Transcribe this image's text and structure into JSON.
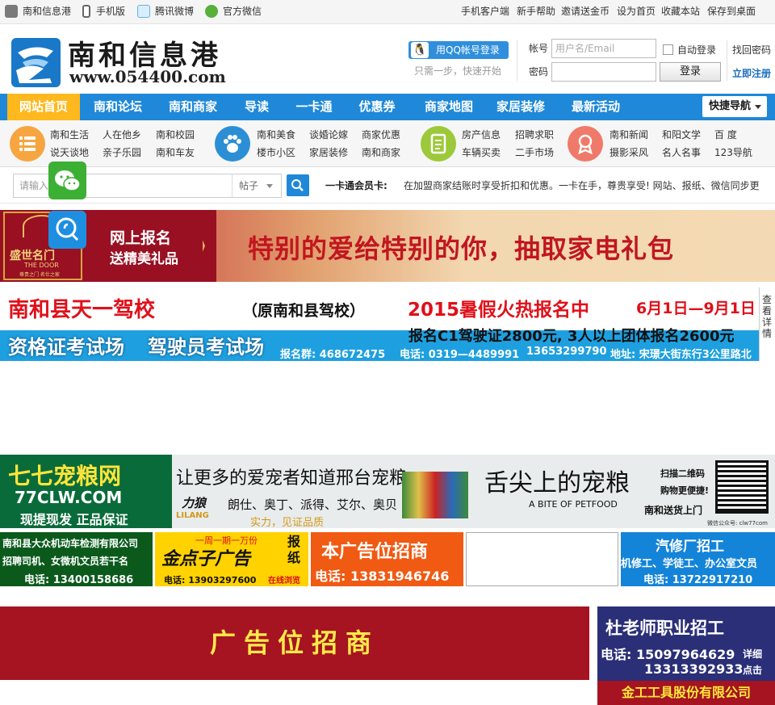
{
  "topbar": {
    "left": [
      {
        "label": "南和信息港",
        "icon": "home-icon"
      },
      {
        "label": "手机版",
        "icon": "phone-icon"
      },
      {
        "label": "腾讯微博",
        "icon": "weibo-icon"
      },
      {
        "label": "官方微信",
        "icon": "wechat-icon"
      }
    ],
    "right": [
      "手机客户端",
      "新手帮助",
      "邀请送金币",
      "设为首页",
      "收藏本站",
      "保存到桌面"
    ]
  },
  "logo": {
    "title": "南和信息港",
    "url": "www.054400.com"
  },
  "qq_login": {
    "button": "用QQ帐号登录",
    "sub": "只需一步，快速开始"
  },
  "login": {
    "account_label": "帐号",
    "account_placeholder": "用户名/Email",
    "password_label": "密码",
    "auto_login": "自动登录",
    "login_button": "登录",
    "forgot": "找回密码",
    "register": "立即注册"
  },
  "nav": {
    "items": [
      "网站首页",
      "南和论坛",
      "南和商家",
      "导读",
      "一卡通",
      "优惠券",
      "商家地图",
      "家居装修",
      "最新活动"
    ],
    "active": "网站首页",
    "quick": "快捷导航"
  },
  "categories": [
    {
      "icon": "list-icon",
      "color": "#f7a540",
      "items": [
        "南和生活",
        "人在他乡",
        "南和校园",
        "说天谈地",
        "亲子乐园",
        "南和车友"
      ]
    },
    {
      "icon": "paw-icon",
      "color": "#2c8fd6",
      "items": [
        "南和美食",
        "谈婚论嫁",
        "商家优惠",
        "楼市小区",
        "家居装修",
        "南和商家"
      ]
    },
    {
      "icon": "document-icon",
      "color": "#9cc93a",
      "items": [
        "房产信息",
        "招聘求职",
        "车辆买卖",
        "二手市场"
      ]
    },
    {
      "icon": "award-icon",
      "color": "#f07a6a",
      "items": [
        "南和新闻",
        "和阳文学",
        "百 度",
        "摄影采风",
        "名人名事",
        "123导航"
      ]
    }
  ],
  "search": {
    "placeholder": "请输入",
    "type": "帖子",
    "card_label": "一卡通会员卡:",
    "card_text": "在加盟商家结账时享受折扣和优惠。一卡在手，尊贵享受! 网站、报纸、微信同步更"
  },
  "ads": {
    "banner1": {
      "brand": "盛世名门",
      "brand_en": "THE DOOR",
      "brand_sub": "尊贵之门 名仕之家",
      "tag1": "网上报名",
      "tag2": "送精美礼品",
      "slogan": "特别的爱给特别的你，抽取家电礼包"
    },
    "banner2": {
      "title": "南和县天一驾校",
      "paren": "（原南和县驾校）",
      "promo": "2015暑假火热报名中",
      "dates": "6月1日—9月1日",
      "side": "查看详情",
      "line2a": "资格证考试场",
      "line2b": "驾驶员考试场",
      "price": "报名C1驾驶证2800元, 3人以上团体报名2600元",
      "group": "报名群: 468672475",
      "tel": "电话: 0319—4489991",
      "mobile": "13653299790",
      "addr": "地址: 宋璟大街东行3公里路北"
    },
    "banner3": {
      "name": "七七宠粮网",
      "domain": "77CLW.COM",
      "tagline": "现提现发 正品保证",
      "slogan": "让更多的爱宠者知道邢台宠粮",
      "brands": "朗仕、奥丁、派得、艾尔、奥贝",
      "lilang": "力狼",
      "lilang_en": "LILANG",
      "quality": "实力，见证品质",
      "bite": "舌尖上的宠粮",
      "bite_en": "A BITE OF PETFOOD",
      "scan": "扫描二维码",
      "buy": "购物更便捷!",
      "deliver": "南和送货上门",
      "wx": "微信公众号: clw77com"
    },
    "small": [
      {
        "l1": "南和县大众机动车检测有限公司",
        "l2": "招聘司机、女微机文员若干名",
        "l3": "电话: 13400158686"
      },
      {
        "top": "一周一期一万份",
        "logo": "金点子广告",
        "side": "报纸",
        "tel": "电话: 13903297600",
        "online": "在线浏览"
      },
      {
        "l1": "本广告位招商",
        "l2": "电话: 13831946746"
      },
      {},
      {
        "l1": "汽修厂招工",
        "l2": "机修工、学徒工、办公室文员",
        "l3": "电话: 13722917210"
      }
    ],
    "big": "广告位招商",
    "job": {
      "title": "杜老师职业招工",
      "tel1": "电话: 15097964629",
      "tel2": "13313392933",
      "detail1": "详细",
      "detail2": "点击",
      "company": "金工工具股份有限公司"
    }
  }
}
